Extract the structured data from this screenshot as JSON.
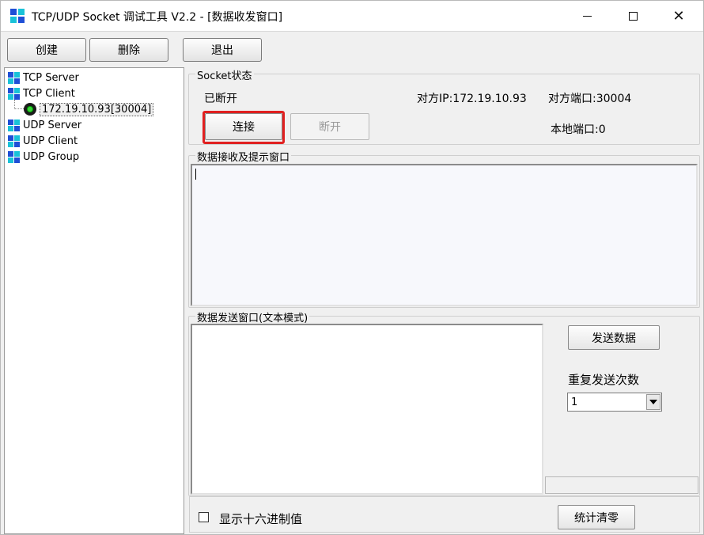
{
  "window": {
    "title": "TCP/UDP Socket 调试工具 V2.2 - [数据收发窗口]",
    "icon": "app-grid-icon"
  },
  "toolbar": {
    "create_label": "创建",
    "delete_label": "删除",
    "exit_label": "退出"
  },
  "tree": {
    "items": [
      {
        "label": "TCP Server"
      },
      {
        "label": "TCP Client"
      },
      {
        "label": "172.19.10.93[30004]"
      },
      {
        "label": "UDP Server"
      },
      {
        "label": "UDP Client"
      },
      {
        "label": "UDP Group"
      }
    ]
  },
  "socket_status": {
    "group_title": "Socket状态",
    "state": "已断开",
    "remote_ip": "对方IP:172.19.10.93",
    "remote_port": "对方端口:30004",
    "local_port": "本地端口:0",
    "connect_label": "连接",
    "disconnect_label": "断开"
  },
  "receive": {
    "group_title": "数据接收及提示窗口",
    "content": ""
  },
  "send": {
    "group_title": "数据发送窗口(文本模式)",
    "content": "",
    "send_label": "发送数据",
    "repeat_label": "重复发送次数",
    "repeat_value": "1"
  },
  "bottom": {
    "hex_label": "显示十六进制值",
    "hex_checked": false,
    "reset_label": "统计清零"
  },
  "colors": {
    "highlight": "#e02020",
    "icon_blue": "#1f4fd6",
    "icon_cyan": "#19c2d8",
    "status_green": "#3bd33b"
  }
}
